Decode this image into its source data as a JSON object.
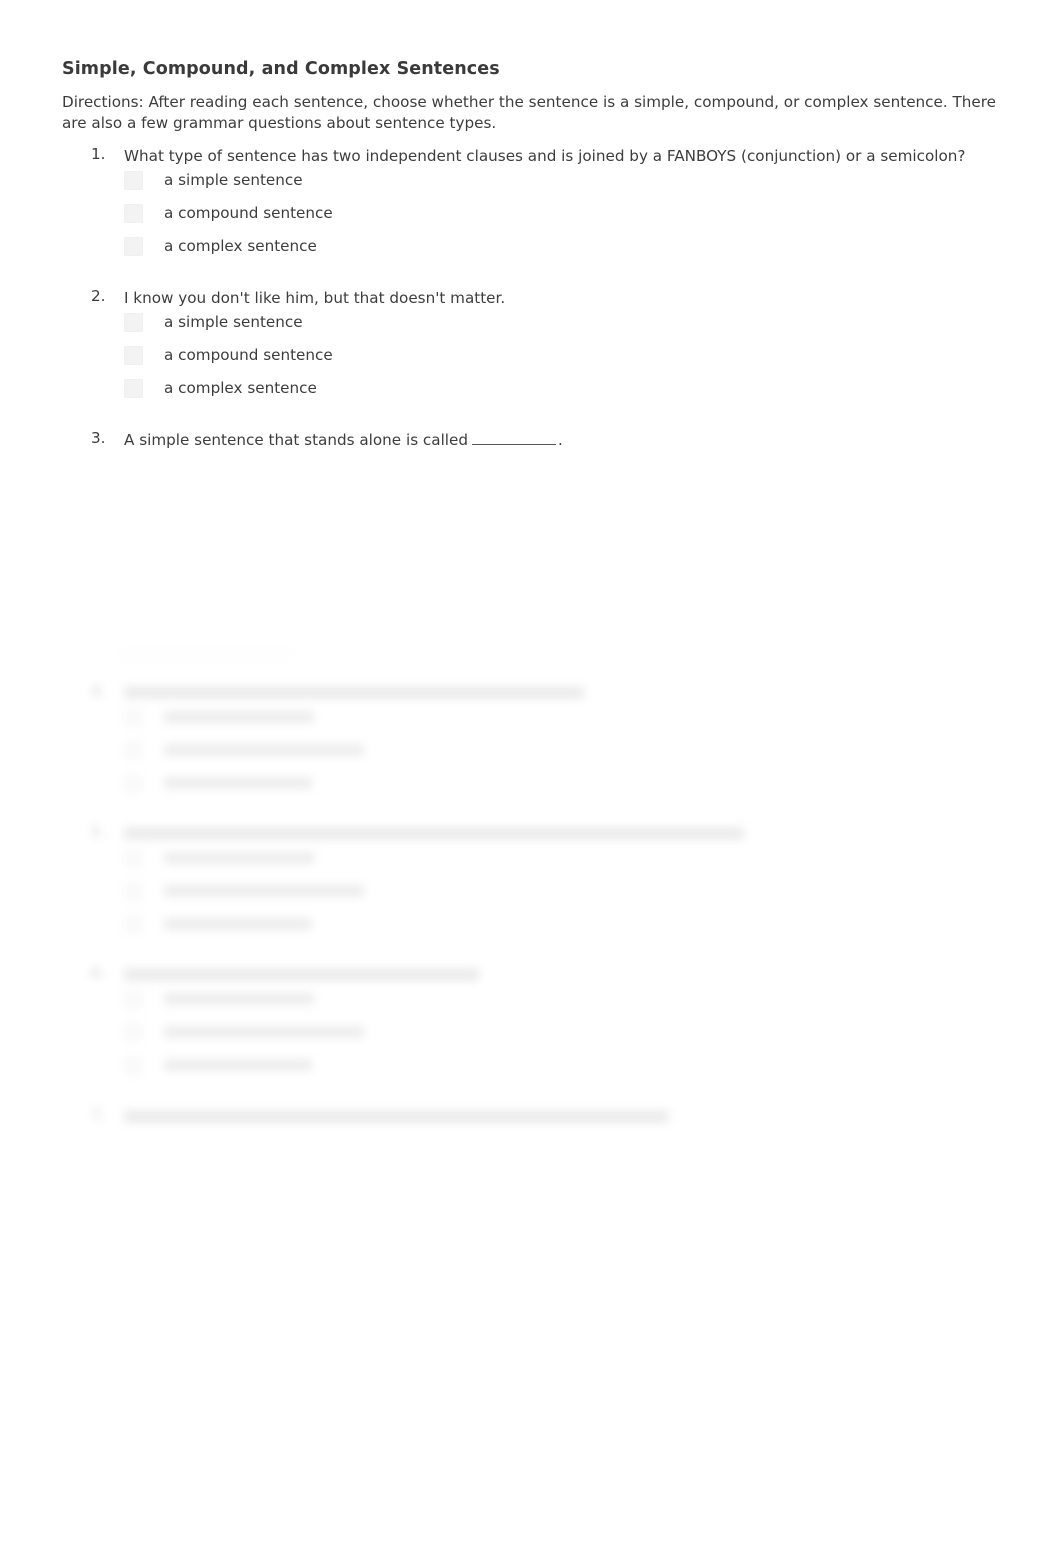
{
  "document": {
    "title": "Simple, Compound, and Complex Sentences",
    "directions": "Directions:  After reading each sentence, choose whether the sentence is a simple, compound, or complex sentence. There are also a few grammar questions about sentence types."
  },
  "questions": [
    {
      "number": "1.",
      "text": "What type of sentence has two independent clauses and is joined by a FANBOYS (conjunction) or a semicolon?",
      "options": [
        {
          "label": "a simple sentence"
        },
        {
          "label": "a compound sentence"
        },
        {
          "label": "a complex sentence"
        }
      ]
    },
    {
      "number": "2.",
      "text": "I know you don't like him, but that doesn't matter.",
      "options": [
        {
          "label": "a simple sentence"
        },
        {
          "label": "a compound sentence"
        },
        {
          "label": "a complex sentence"
        }
      ]
    },
    {
      "number": "3.",
      "text_before_blank": "A simple sentence that stands alone is called",
      "text_after_blank": ".",
      "options": []
    }
  ],
  "preview_questions": [
    {
      "number": "4.",
      "text": "",
      "options": [
        {
          "label": ""
        },
        {
          "label": ""
        },
        {
          "label": ""
        }
      ]
    },
    {
      "number": "5.",
      "text": "",
      "options": [
        {
          "label": ""
        },
        {
          "label": ""
        },
        {
          "label": ""
        }
      ]
    },
    {
      "number": "6.",
      "text": "",
      "options": [
        {
          "label": ""
        },
        {
          "label": ""
        },
        {
          "label": ""
        }
      ]
    },
    {
      "number": "7.",
      "text": "",
      "options": []
    }
  ]
}
